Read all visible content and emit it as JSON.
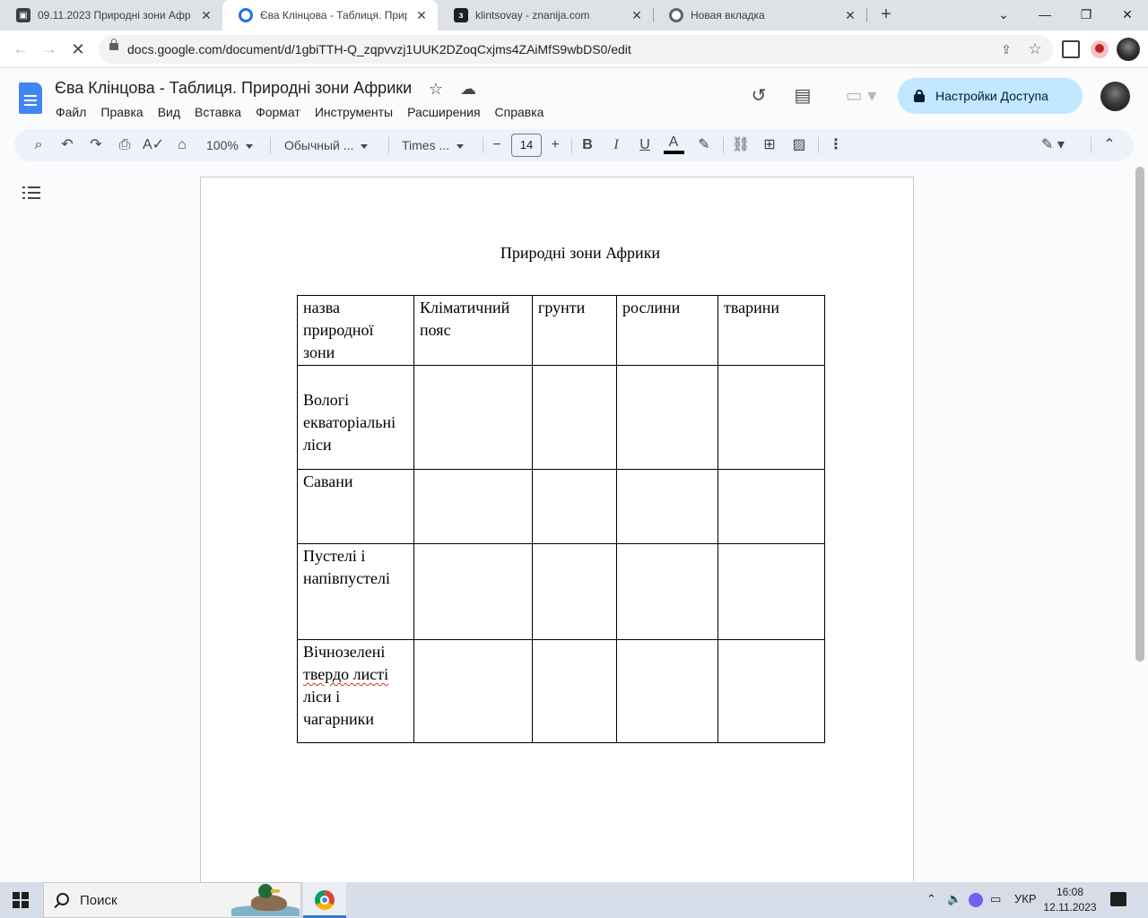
{
  "browser": {
    "tabs": [
      {
        "label": "09.11.2023 Природні зони Афр",
        "active": false
      },
      {
        "label": "Єва Клінцова - Таблиця. Приро",
        "active": true
      },
      {
        "label": "klintsovay - znanija.com",
        "active": false
      },
      {
        "label": "Новая вкладка",
        "active": false
      }
    ],
    "url": "docs.google.com/document/d/1gbiTTH-Q_zqpvvzj1UUK2DZoqCxjms4ZAiMfS9wbDS0/edit"
  },
  "docs": {
    "title": "Єва Клінцова - Таблиця. Природні зони Африки",
    "menu": [
      "Файл",
      "Правка",
      "Вид",
      "Вставка",
      "Формат",
      "Инструменты",
      "Расширения",
      "Справка"
    ],
    "share_label": "Настройки Доступа"
  },
  "toolbar": {
    "zoom": "100%",
    "style": "Обычный ...",
    "font": "Times ...",
    "font_size": "14"
  },
  "document": {
    "heading": "Природні зони Африки",
    "table": {
      "header": [
        "назва природної зони",
        "Кліматичний пояс",
        "грунти",
        "рослини",
        "тварини"
      ],
      "rows": [
        "Вологі екваторіальні ліси",
        "Савани",
        "Пустелі і напівпустелі",
        "Вічнозелені твердо листі ліси і чагарники"
      ]
    }
  },
  "taskbar": {
    "search_placeholder": "Поиск",
    "language": "УКР",
    "time": "16:08",
    "date": "12.11.2023"
  }
}
